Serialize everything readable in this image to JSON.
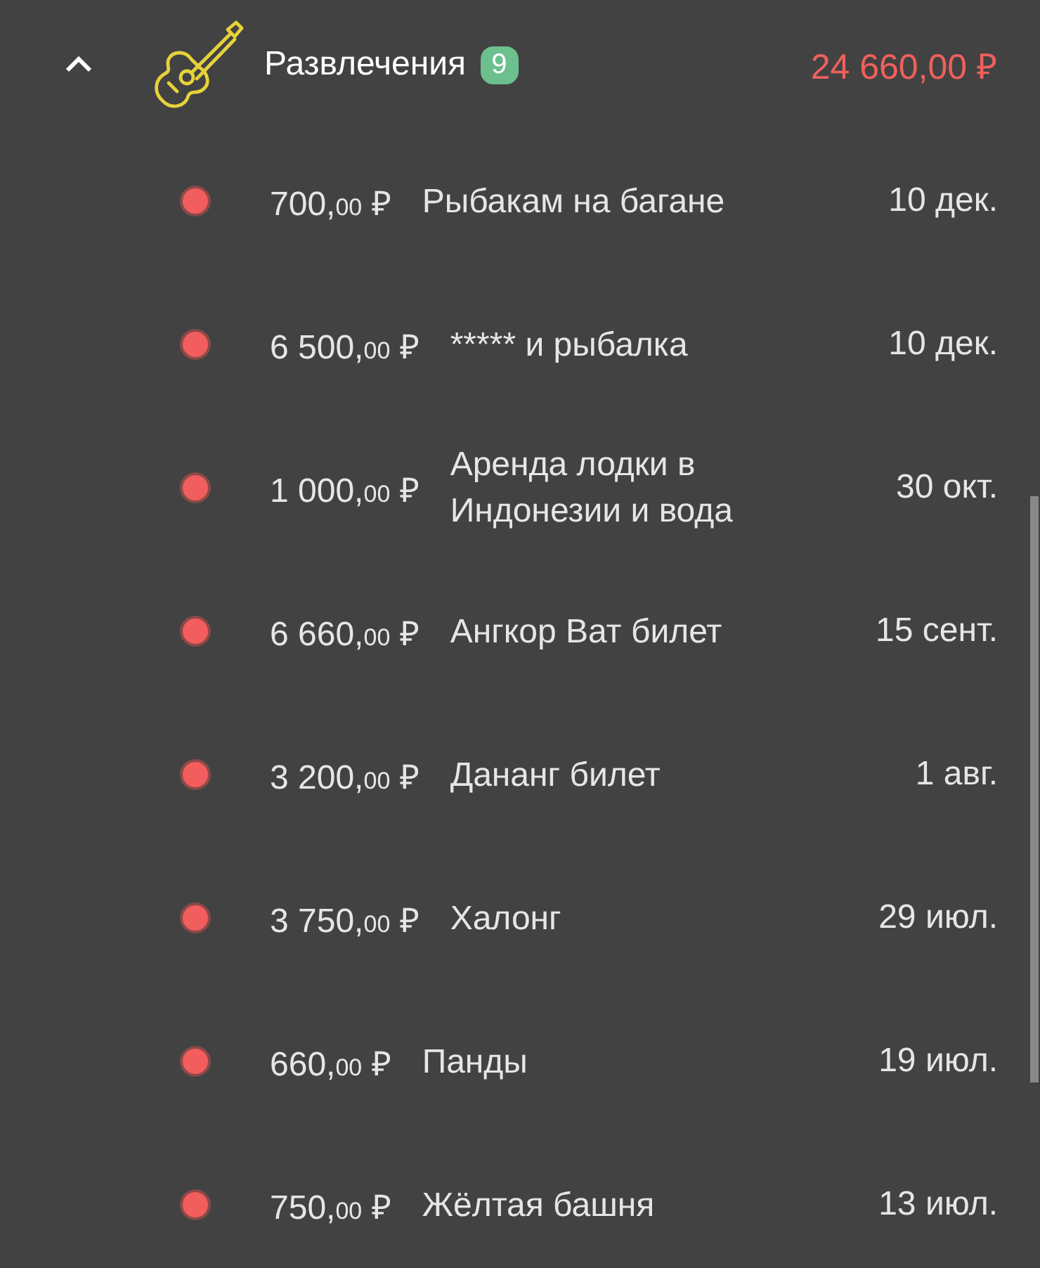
{
  "category": {
    "name": "Развлечения",
    "count": "9",
    "total": "24 660,00 ₽",
    "expanded": true
  },
  "items": [
    {
      "amount": "700,",
      "cents": "00",
      "currency": "₽",
      "description": "Рыбакам на багане",
      "date": "10 дек."
    },
    {
      "amount": "6 500,",
      "cents": "00",
      "currency": "₽",
      "description": "***** и рыбалка",
      "date": "10 дек."
    },
    {
      "amount": "1 000,",
      "cents": "00",
      "currency": "₽",
      "description": "Аренда лодки в Индонезии и вода",
      "date": "30 окт."
    },
    {
      "amount": "6 660,",
      "cents": "00",
      "currency": "₽",
      "description": "Ангкор Ват билет",
      "date": "15 сент."
    },
    {
      "amount": "3 200,",
      "cents": "00",
      "currency": "₽",
      "description": "Дананг билет",
      "date": "1 авг."
    },
    {
      "amount": "3 750,",
      "cents": "00",
      "currency": "₽",
      "description": "Халонг",
      "date": "29 июл."
    },
    {
      "amount": "660,",
      "cents": "00",
      "currency": "₽",
      "description": "Панды",
      "date": "19 июл."
    },
    {
      "amount": "750,",
      "cents": "00",
      "currency": "₽",
      "description": "Жёлтая башня",
      "date": "13 июл."
    }
  ]
}
